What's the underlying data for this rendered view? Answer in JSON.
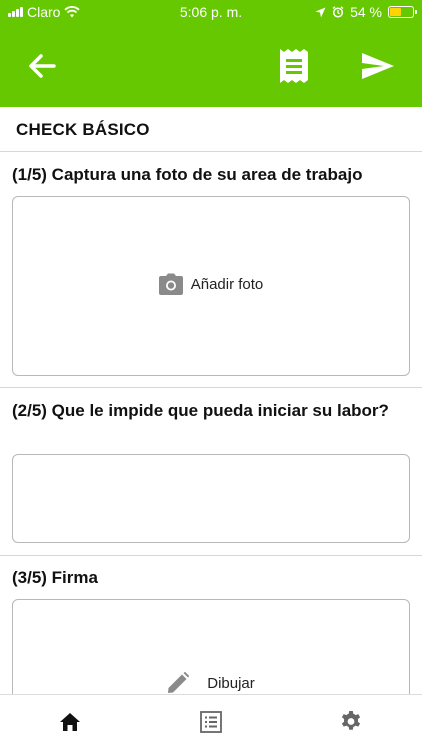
{
  "status_bar": {
    "carrier": "Claro",
    "time": "5:06 p. m.",
    "battery_percent_text": "54 %",
    "battery_level": 0.54,
    "battery_color": "#ffd400"
  },
  "header": {
    "background_color": "#66c800",
    "back_icon": "arrow-left-icon",
    "document_icon": "receipt-icon",
    "send_icon": "send-icon"
  },
  "form": {
    "title": "CHECK BÁSICO",
    "questions": [
      {
        "label": "(1/5) Captura una foto de su area de trabajo",
        "action_label": "Añadir foto",
        "action_icon": "camera-icon"
      },
      {
        "label": "(2/5) Que le impide que pueda iniciar su labor?",
        "value": ""
      },
      {
        "label": "(3/5) Firma",
        "action_label": "Dibujar",
        "action_icon": "pencil-icon"
      }
    ]
  },
  "bottom_nav": {
    "items": [
      {
        "icon": "home-icon",
        "active": true
      },
      {
        "icon": "list-icon",
        "active": false
      },
      {
        "icon": "gear-icon",
        "active": false
      }
    ]
  }
}
